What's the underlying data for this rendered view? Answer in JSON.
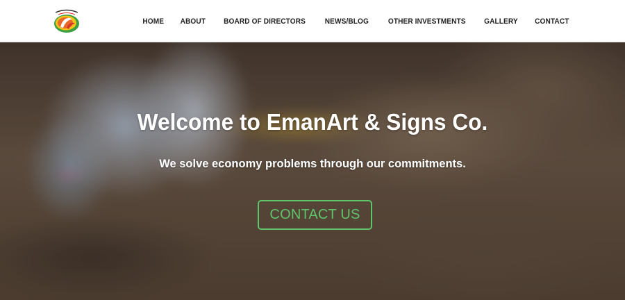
{
  "header": {
    "logo_icon": "emanart-logo-icon",
    "nav": [
      {
        "label": "HOME"
      },
      {
        "label": "ABOUT"
      },
      {
        "label": "BOARD OF DIRECTORS"
      },
      {
        "label": "NEWS/BLOG"
      },
      {
        "label": "OTHER INVESTMENTS"
      },
      {
        "label": "GALLERY"
      },
      {
        "label": "CONTACT"
      }
    ]
  },
  "hero": {
    "title": "Welcome to EmanArt & Signs Co.",
    "subtitle": "We solve economy problems through our commitments.",
    "cta_label": "CONTACT US",
    "accent_color": "#5fc46a"
  }
}
